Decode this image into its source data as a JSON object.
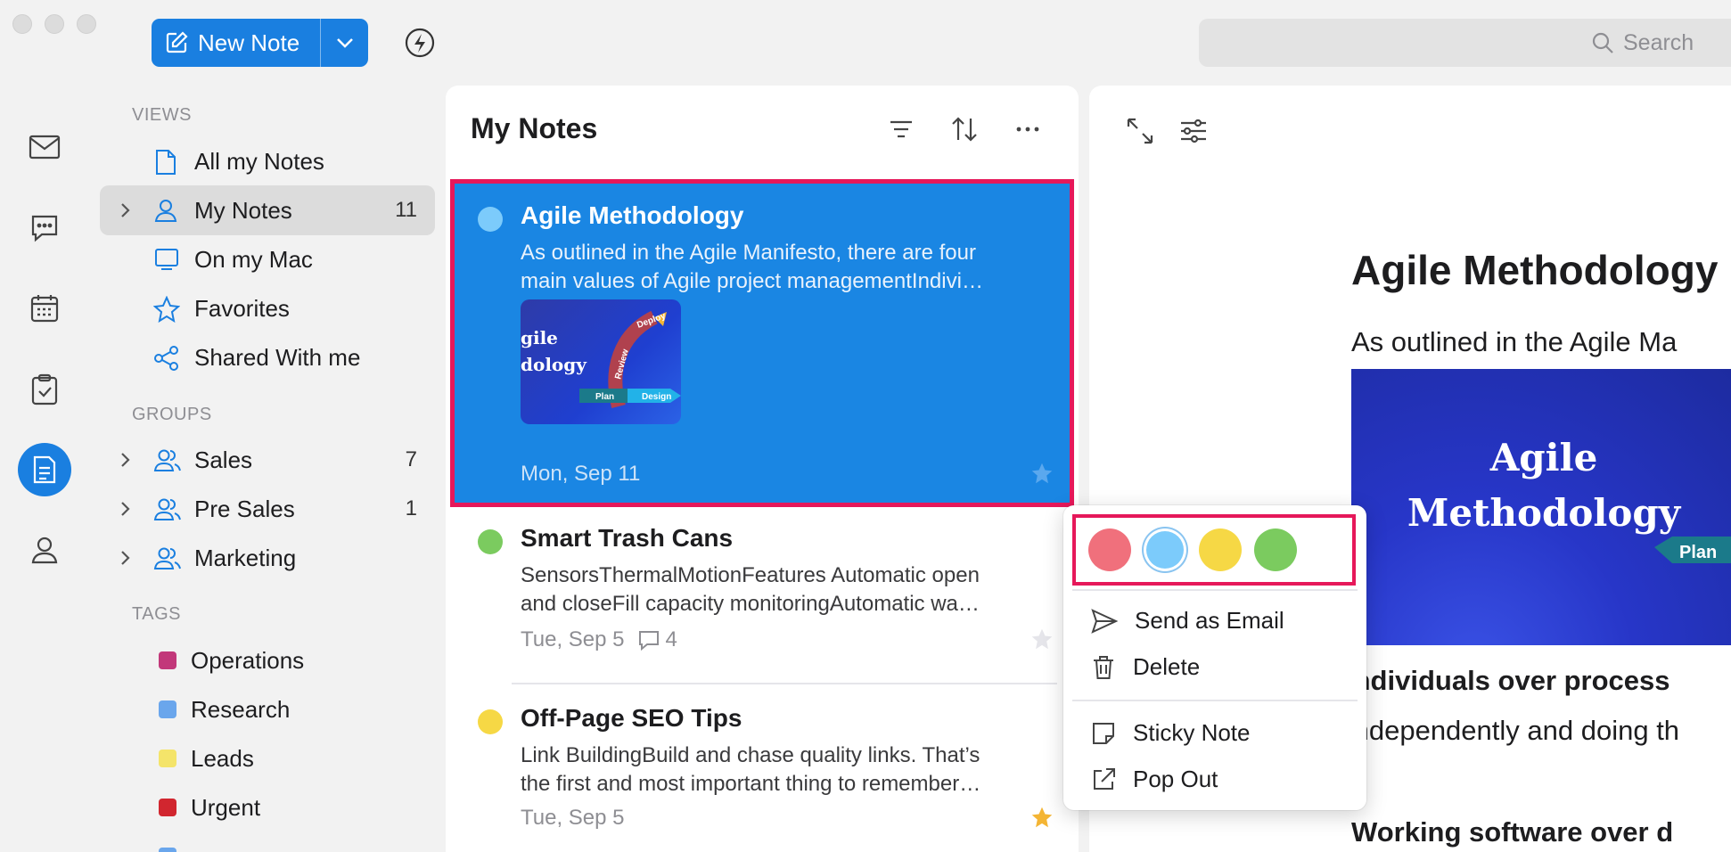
{
  "toolbar": {
    "new_note_label": "New Note",
    "search_placeholder": "Search"
  },
  "sidebar": {
    "views_header": "VIEWS",
    "views": [
      {
        "label": "All my Notes",
        "icon": "document-icon"
      },
      {
        "label": "My Notes",
        "icon": "person-icon",
        "count": "11"
      },
      {
        "label": "On my Mac",
        "icon": "monitor-icon"
      },
      {
        "label": "Favorites",
        "icon": "star-icon"
      },
      {
        "label": "Shared With me",
        "icon": "share-icon"
      }
    ],
    "groups_header": "GROUPS",
    "groups": [
      {
        "label": "Sales",
        "count": "7"
      },
      {
        "label": "Pre Sales",
        "count": "1"
      },
      {
        "label": "Marketing",
        "count": ""
      }
    ],
    "tags_header": "TAGS",
    "tags": [
      {
        "label": "Operations",
        "color": "#c2387a"
      },
      {
        "label": "Research",
        "color": "#6aa6ec"
      },
      {
        "label": "Leads",
        "color": "#f4e46a"
      },
      {
        "label": "Urgent",
        "color": "#d1262f"
      }
    ]
  },
  "list": {
    "title": "My Notes",
    "notes": [
      {
        "title": "Agile Methodology",
        "preview_1": "As outlined in the Agile Manifesto, there are four",
        "preview_2": "main values of Agile project managementIndivi…",
        "date": "Mon, Sep 11",
        "color": "#7ccbfb",
        "thumb_line_1": "gile",
        "thumb_line_2": "dology",
        "thumb_deploy": "Deploy",
        "thumb_review": "Review",
        "thumb_plan": "Plan",
        "thumb_design": "Design"
      },
      {
        "title": "Smart Trash Cans",
        "preview_1": "SensorsThermalMotionFeatures Automatic open",
        "preview_2": "and closeFill capacity monitoringAutomatic wa…",
        "date": "Tue, Sep 5",
        "comments": "4",
        "color": "#7bcb5f"
      },
      {
        "title": "Off-Page SEO Tips",
        "preview_1": "Link BuildingBuild and chase quality links. That’s",
        "preview_2": "the first and most important thing to remember…",
        "date": "Tue, Sep 5",
        "color": "#f6d845",
        "favorite": true
      }
    ]
  },
  "editor": {
    "title": "Agile Methodology",
    "intro": "As outlined in the Agile Ma",
    "image_line_1": "Agile",
    "image_line_2": "Methodology",
    "image_plan": "Plan",
    "heading_1": "Individuals over process",
    "para_1": "Independently and doing th",
    "heading_2": "Working software over d"
  },
  "context_menu": {
    "colors": [
      "#f0707c",
      "#7ccbfb",
      "#f6d845",
      "#7bcb5f"
    ],
    "send_email": "Send as Email",
    "delete": "Delete",
    "sticky_note": "Sticky Note",
    "pop_out": "Pop Out"
  }
}
